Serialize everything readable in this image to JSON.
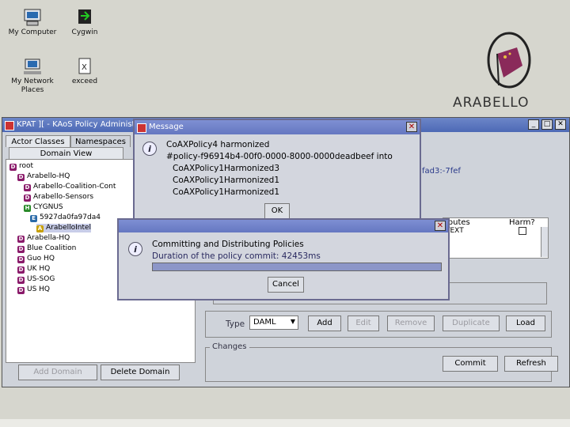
{
  "desktop": {
    "icons": [
      {
        "label": "My Computer"
      },
      {
        "label": "Cygwin"
      },
      {
        "label": "My Network Places"
      },
      {
        "label": "exceed"
      }
    ],
    "logo_text": "ARABELLO"
  },
  "main_window": {
    "title": "KPAT ][ - KAoS Policy Administrat",
    "tabs": [
      "Actor Classes",
      "Namespaces"
    ],
    "subtab": "Domain View",
    "tree": [
      {
        "icon": "D",
        "label": "root"
      },
      {
        "icon": "D",
        "label": "Arabello-HQ"
      },
      {
        "icon": "D",
        "label": "Arabello-Coalition-Cont"
      },
      {
        "icon": "D",
        "label": "Arabello-Sensors"
      },
      {
        "icon": "H",
        "label": "CYGNUS"
      },
      {
        "icon": "E",
        "label": "5927da0fa97da4"
      },
      {
        "icon": "A",
        "label": "ArabelloIntel"
      },
      {
        "icon": "D",
        "label": "Arabella-HQ"
      },
      {
        "icon": "D",
        "label": "Blue Coalition"
      },
      {
        "icon": "D",
        "label": "Guo HQ"
      },
      {
        "icon": "D",
        "label": "UK HQ"
      },
      {
        "icon": "D",
        "label": "US-SOG"
      },
      {
        "icon": "D",
        "label": "US HQ"
      }
    ],
    "add_domain_label": "Add Domain",
    "delete_domain_label": "Delete Domain",
    "policy_id_fragment": "fad3:-7fef",
    "table_headers": [
      "ibutes",
      "Harm?"
    ],
    "table_row": [
      "TEXT",
      ""
    ],
    "type_label": "Type",
    "type_value": "DAML",
    "buttons": {
      "add": "Add",
      "edit": "Edit",
      "remove": "Remove",
      "duplicate": "Duplicate",
      "load": "Load"
    },
    "changes_label": "Changes",
    "commit_label": "Commit",
    "refresh_label": "Refresh"
  },
  "message_dialog": {
    "title": "Message",
    "lines": [
      "CoAXPolicy4 harmonized",
      "#policy-f96914b4-00f0-0000-8000-0000deadbeef into",
      "CoAXPolicy1Harmonized3",
      "CoAXPolicy1Harmonized1",
      "CoAXPolicy1Harmonized1"
    ],
    "ok_label": "OK"
  },
  "progress_dialog": {
    "line1": "Committing and Distributing Policies",
    "line2": "Duration of the policy commit: 42453ms",
    "progress": 1.0,
    "cancel_label": "Cancel"
  },
  "colors": {
    "accent": "#4d69b5",
    "domain_icon": "#8a1a6a",
    "host_icon": "#2a8a2a",
    "entity_icon": "#2a6aa8",
    "actor_icon": "#c8a000"
  }
}
